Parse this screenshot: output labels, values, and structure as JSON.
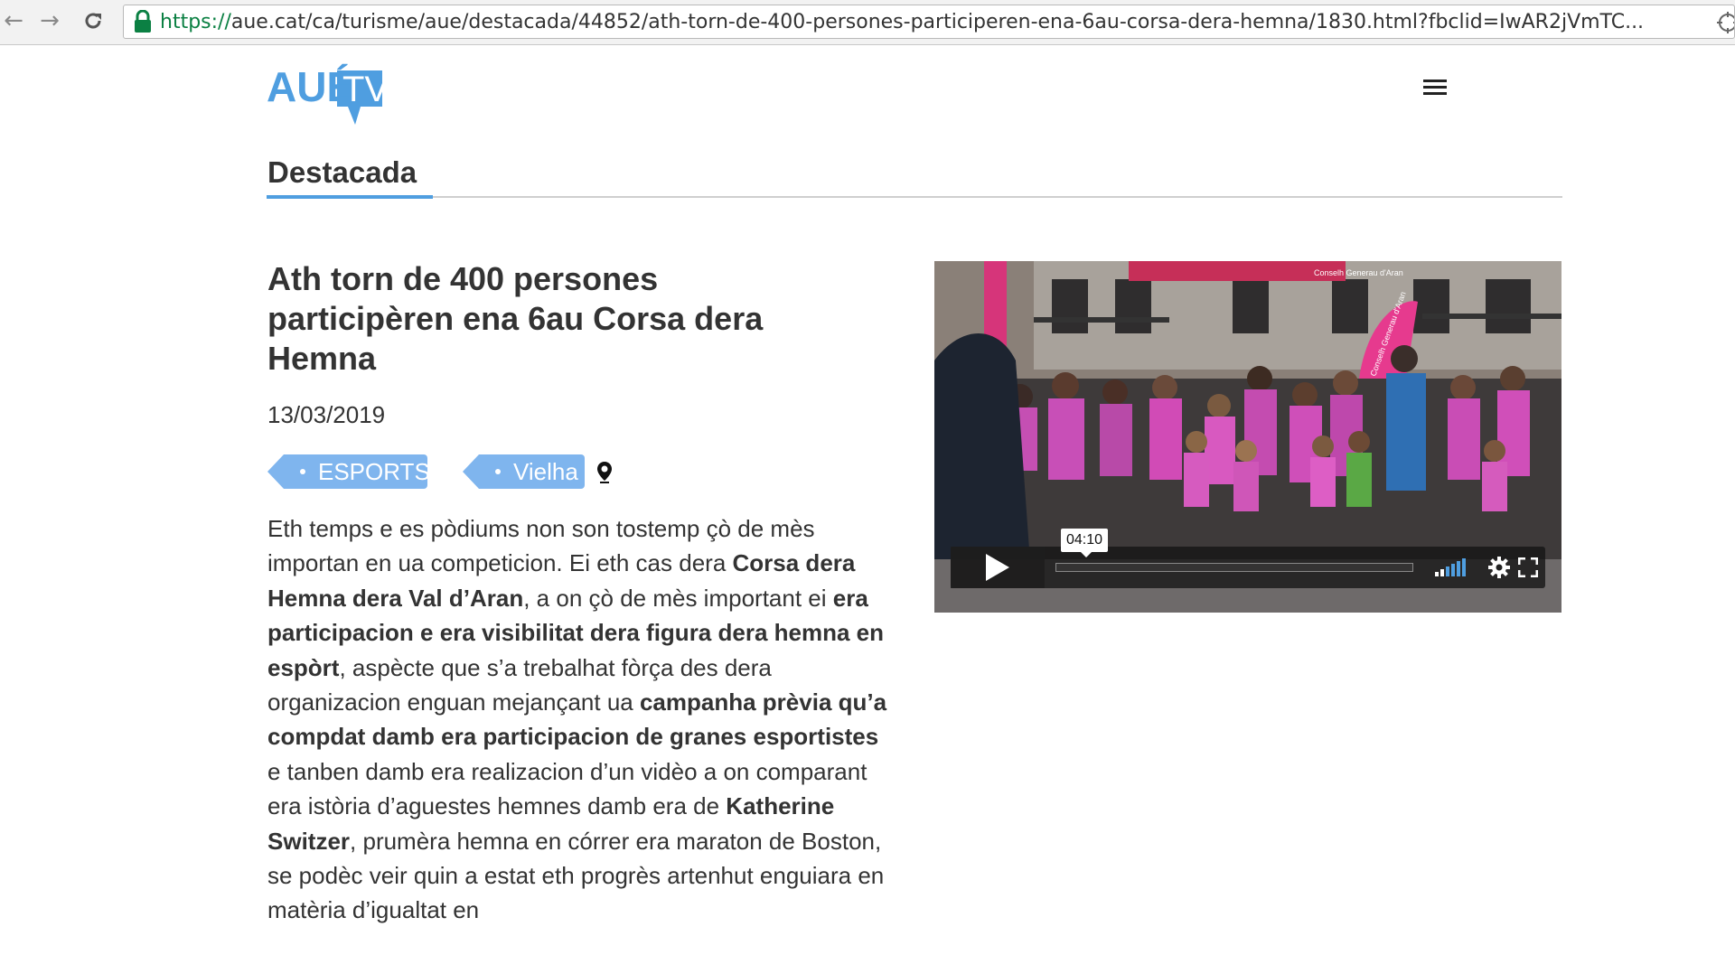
{
  "browser": {
    "url_scheme": "https://",
    "url_rest": "aue.cat/ca/turisme/aue/destacada/44852/ath-torn-de-400-persones-participeren-ena-6au-corsa-dera-hemna/1830.html?fbclid=IwAR2jVmTC..."
  },
  "site": {
    "logo_text_aue": "AUÉ",
    "logo_text_tv": "TV",
    "section_title": "Destacada"
  },
  "article": {
    "title_lines": [
      "Ath torn de 400 persones",
      "participèren ena 6au Corsa dera",
      "Hemna"
    ],
    "date": "13/03/2019",
    "tags": [
      "ESPORTS",
      "Vielha"
    ],
    "body": [
      {
        "t": "Eth temps e es pòdiums non son tostemp çò de mès importan en ua competicion. Ei eth cas dera ",
        "b": false
      },
      {
        "t": "Corsa dera Hemna dera Val d’Aran",
        "b": true
      },
      {
        "t": ", a on çò de mès important ei ",
        "b": false
      },
      {
        "t": "era participacion e era visibilitat dera figura dera hemna en espòrt",
        "b": true
      },
      {
        "t": ", aspècte que s’a trebalhat fòrça des dera organizacion enguan mejançant ua ",
        "b": false
      },
      {
        "t": "campanha prèvia qu’a compdat damb era participacion de granes esportistes",
        "b": true
      },
      {
        "t": " e tanben damb era realizacion d’un vidèo a on comparant era istòria d’aguestes hemnes damb era de ",
        "b": false
      },
      {
        "t": "Katherine Switzer",
        "b": true
      },
      {
        "t": ", prumèra hemna en córrer era maraton de Boston, se podèc veir quin a estat eth progrès artenhut enguiara en matèria d’igualtat en",
        "b": false
      }
    ]
  },
  "video": {
    "time_tooltip": "04:10",
    "banner_text": "Conselh Generau d'Aran",
    "flag_text": "Conselh Generau d'Aran"
  }
}
